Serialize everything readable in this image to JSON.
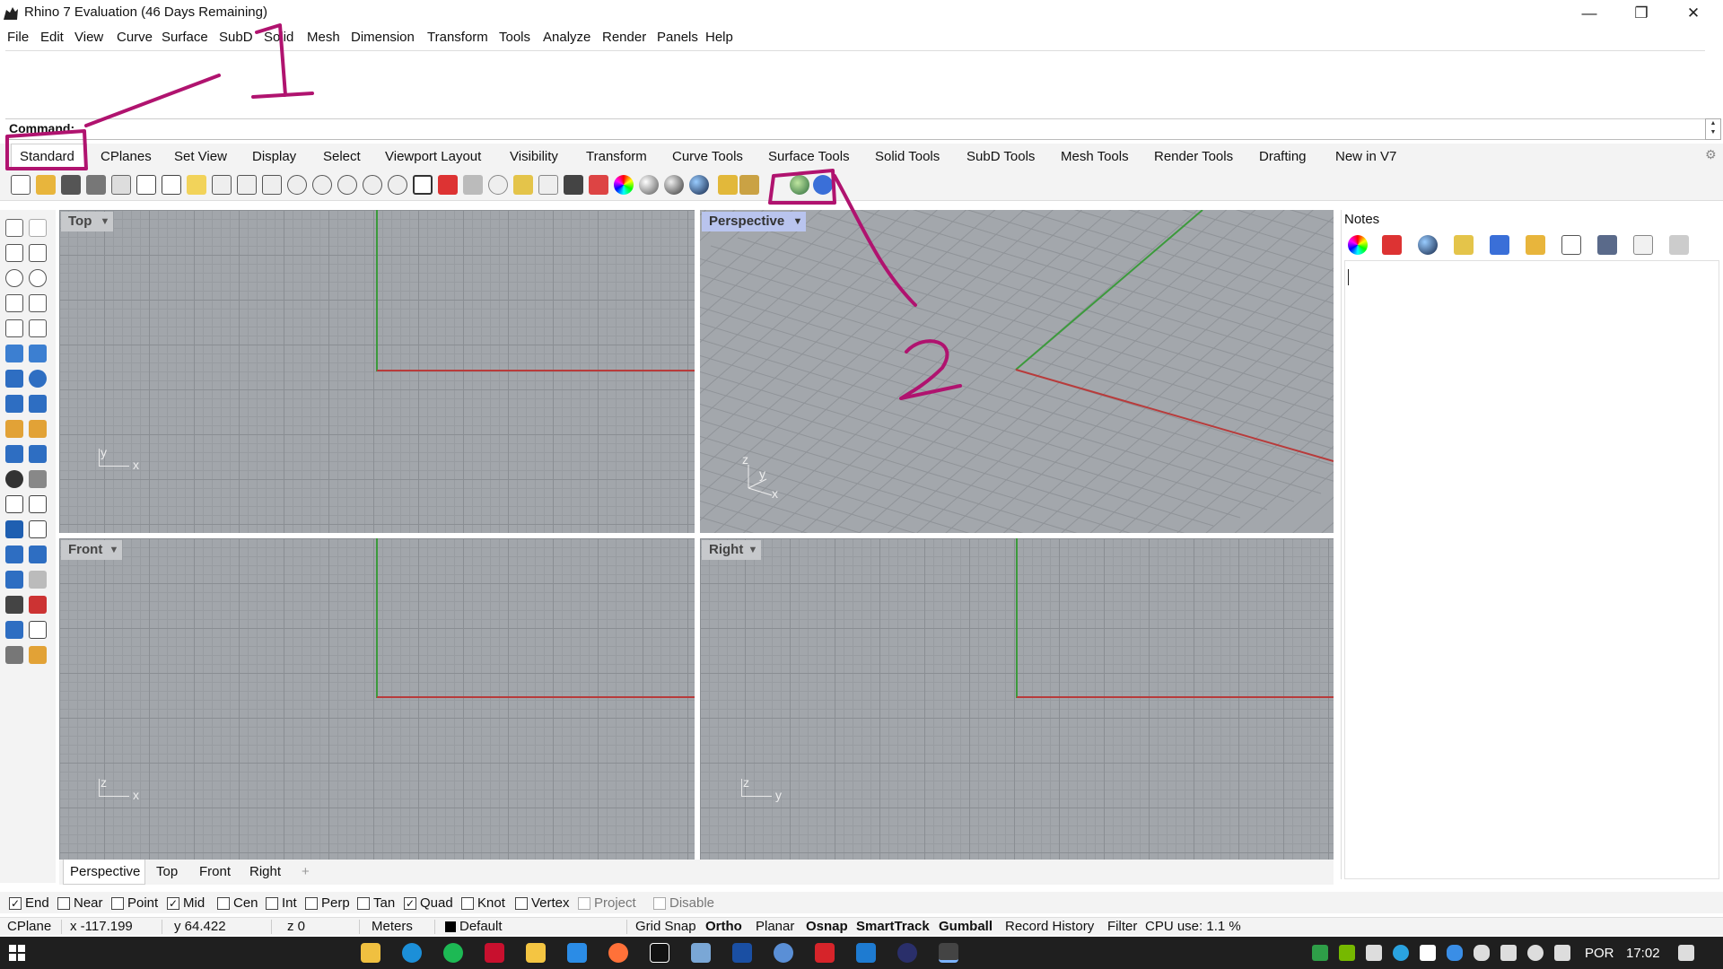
{
  "window": {
    "title": "Rhino 7 Evaluation (46 Days Remaining)",
    "minimize_icon": "—",
    "restore_icon": "❐",
    "close_icon": "✕"
  },
  "menu": [
    "File",
    "Edit",
    "View",
    "Curve",
    "Surface",
    "SubD",
    "Solid",
    "Mesh",
    "Dimension",
    "Transform",
    "Tools",
    "Analyze",
    "Render",
    "Panels",
    "Help"
  ],
  "command": {
    "label": "Command:"
  },
  "toolbar_tabs": [
    "Standard",
    "CPlanes",
    "Set View",
    "Display",
    "Select",
    "Viewport Layout",
    "Visibility",
    "Transform",
    "Curve Tools",
    "Surface Tools",
    "Solid Tools",
    "SubD Tools",
    "Mesh Tools",
    "Render Tools",
    "Drafting",
    "New in V7"
  ],
  "active_toolbar_tab": "Standard",
  "toolbar_icons": [
    "new-icon",
    "open-icon",
    "save-icon",
    "print-icon",
    "import-icon",
    "copy-icon",
    "paste-icon",
    "undo-icon",
    "pan-icon",
    "move-icon",
    "zoom-icon",
    "zoom-window-icon",
    "zoom-extents-icon",
    "zoom-selected-icon",
    "rotate-view-icon",
    "four-viewports-icon",
    "car-icon",
    "hide-icon",
    "point-icon",
    "bulb-icon",
    "lock-icon",
    "layer-icon",
    "color-wheel-icon",
    "sphere-icon",
    "render-sphere-icon",
    "material-sphere-icon",
    "dimension-icon",
    "gear-cogs-icon",
    "globe-icon",
    "help-icon"
  ],
  "viewports": {
    "top": {
      "title": "Top",
      "axis1": "y",
      "axis2": "x"
    },
    "perspective": {
      "title": "Perspective",
      "axisz": "z",
      "axisy": "y",
      "axisx": "x"
    },
    "front": {
      "title": "Front",
      "axis1": "z",
      "axis2": "x"
    },
    "right": {
      "title": "Right",
      "axis1": "z",
      "axis2": "y"
    }
  },
  "viewport_tabs": [
    "Perspective",
    "Top",
    "Front",
    "Right"
  ],
  "viewport_tab_add": "+",
  "notes": {
    "label": "Notes",
    "content": ""
  },
  "osnaps": [
    {
      "label": "End",
      "checked": true,
      "enabled": true
    },
    {
      "label": "Near",
      "checked": false,
      "enabled": true
    },
    {
      "label": "Point",
      "checked": false,
      "enabled": true
    },
    {
      "label": "Mid",
      "checked": true,
      "enabled": true
    },
    {
      "label": "Cen",
      "checked": false,
      "enabled": true
    },
    {
      "label": "Int",
      "checked": false,
      "enabled": true
    },
    {
      "label": "Perp",
      "checked": false,
      "enabled": true
    },
    {
      "label": "Tan",
      "checked": false,
      "enabled": true
    },
    {
      "label": "Quad",
      "checked": true,
      "enabled": true
    },
    {
      "label": "Knot",
      "checked": false,
      "enabled": true
    },
    {
      "label": "Vertex",
      "checked": false,
      "enabled": true
    },
    {
      "label": "Project",
      "checked": false,
      "enabled": false
    },
    {
      "label": "Disable",
      "checked": false,
      "enabled": false
    }
  ],
  "status": {
    "cplane": "CPlane",
    "x": "x -117.199",
    "y": "y 64.422",
    "z": "z 0",
    "units": "Meters",
    "layer": "Default",
    "grid_snap": "Grid Snap",
    "ortho": "Ortho",
    "planar": "Planar",
    "osnap": "Osnap",
    "smarttrack": "SmartTrack",
    "gumball": "Gumball",
    "record_history": "Record History",
    "filter": "Filter",
    "cpu": "CPU use: 1.1 %"
  },
  "taskbar": {
    "language": "POR",
    "time": "17:02"
  },
  "annotations": {
    "one": "1",
    "two": "2"
  },
  "colors": {
    "x_axis": "#b83b3b",
    "y_axis": "#3c9a3c",
    "annotation": "#b0136f",
    "active_viewport_title": "#b9c4ee"
  }
}
